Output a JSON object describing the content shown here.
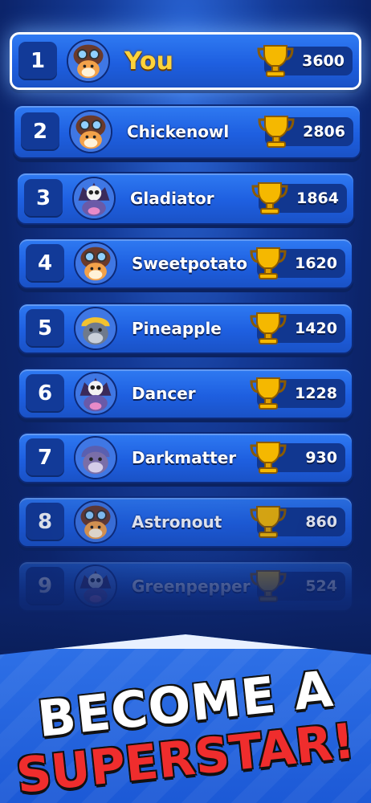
{
  "leaderboard": {
    "entries": [
      {
        "rank": "1",
        "name": "You",
        "score": "3600",
        "avatar": "owl-aviator-avatar",
        "highlight": true
      },
      {
        "rank": "2",
        "name": "Chickenowl",
        "score": "2806",
        "avatar": "owl-aviator-avatar"
      },
      {
        "rank": "3",
        "name": "Gladiator",
        "score": "1864",
        "avatar": "skull-helmet-avatar"
      },
      {
        "rank": "4",
        "name": "Sweetpotato",
        "score": "1620",
        "avatar": "owl-aviator-avatar"
      },
      {
        "rank": "5",
        "name": "Pineapple",
        "score": "1420",
        "avatar": "gorilla-bowl-cut-avatar"
      },
      {
        "rank": "6",
        "name": "Dancer",
        "score": "1228",
        "avatar": "skull-helmet-avatar"
      },
      {
        "rank": "7",
        "name": "Darkmatter",
        "score": "930",
        "avatar": "gorilla-helmet-avatar"
      },
      {
        "rank": "8",
        "name": "Astronout",
        "score": "860",
        "avatar": "owl-aviator-avatar"
      },
      {
        "rank": "9",
        "name": "Greenpepper",
        "score": "524",
        "avatar": "skull-helmet-avatar"
      }
    ],
    "trophy_icon": "trophy-icon"
  },
  "promo": {
    "line1": "BECOME A",
    "line2": "SUPERSTAR!"
  },
  "colors": {
    "row": "#1e5fe0",
    "highlight_name": "#ffd33a",
    "headline_red": "#ef2d2d",
    "trophy": "#f5b800"
  }
}
